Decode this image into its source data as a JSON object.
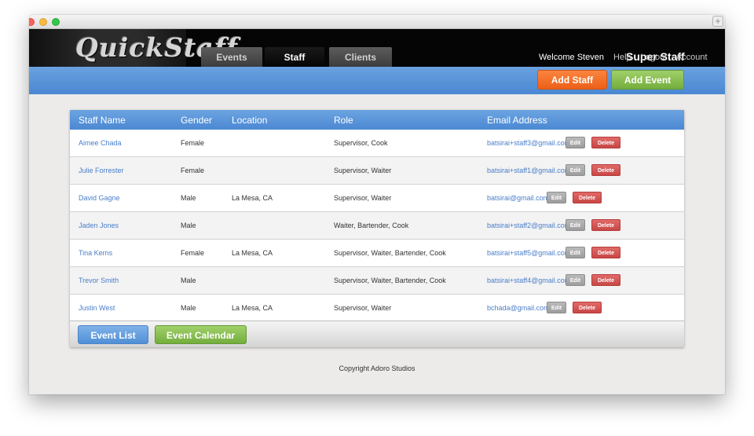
{
  "app": {
    "logo": "QuickStaff",
    "brand": "Super Staff"
  },
  "nav": {
    "tabs": [
      {
        "label": "Events",
        "active": false
      },
      {
        "label": "Staff",
        "active": true
      },
      {
        "label": "Clients",
        "active": false
      }
    ]
  },
  "user": {
    "welcome": "Welcome Steven",
    "links": [
      "Help",
      "Logout",
      "Account"
    ]
  },
  "actions": {
    "add_staff": "Add Staff",
    "add_event": "Add Event"
  },
  "table": {
    "columns": [
      "Staff Name",
      "Gender",
      "Location",
      "Role",
      "Email Address"
    ],
    "edit_label": "Edit",
    "delete_label": "Delete",
    "rows": [
      {
        "name": "Aimee Chada",
        "gender": "Female",
        "location": "",
        "role": "Supervisor, Cook",
        "email": "batsirai+staff3@gmail.com"
      },
      {
        "name": "Julie Forrester",
        "gender": "Female",
        "location": "",
        "role": "Supervisor, Waiter",
        "email": "batsirai+staff1@gmail.com"
      },
      {
        "name": "David Gagne",
        "gender": "Male",
        "location": "La Mesa, CA",
        "role": "Supervisor, Waiter",
        "email": "batsirai@gmail.com"
      },
      {
        "name": "Jaden Jones",
        "gender": "Male",
        "location": "",
        "role": "Waiter, Bartender, Cook",
        "email": "batsirai+staff2@gmail.com"
      },
      {
        "name": "Tina Kerns",
        "gender": "Female",
        "location": "La Mesa, CA",
        "role": "Supervisor, Waiter, Bartender, Cook",
        "email": "batsirai+staff5@gmail.com"
      },
      {
        "name": "Trevor Smith",
        "gender": "Male",
        "location": "",
        "role": "Supervisor, Waiter, Bartender, Cook",
        "email": "batsirai+staff4@gmail.com"
      },
      {
        "name": "Justin West",
        "gender": "Male",
        "location": "La Mesa, CA",
        "role": "Supervisor, Waiter",
        "email": "bchada@gmail.com"
      }
    ]
  },
  "footer_actions": {
    "event_list": "Event List",
    "event_calendar": "Event Calendar"
  },
  "copyright": "Copyright Adoro Studios",
  "colors": {
    "accent_blue": "#4b88d3",
    "add_staff_orange": "#ec5f17",
    "add_event_green": "#74ae3c",
    "delete_red": "#c84745",
    "link_blue": "#4a7ec9"
  }
}
